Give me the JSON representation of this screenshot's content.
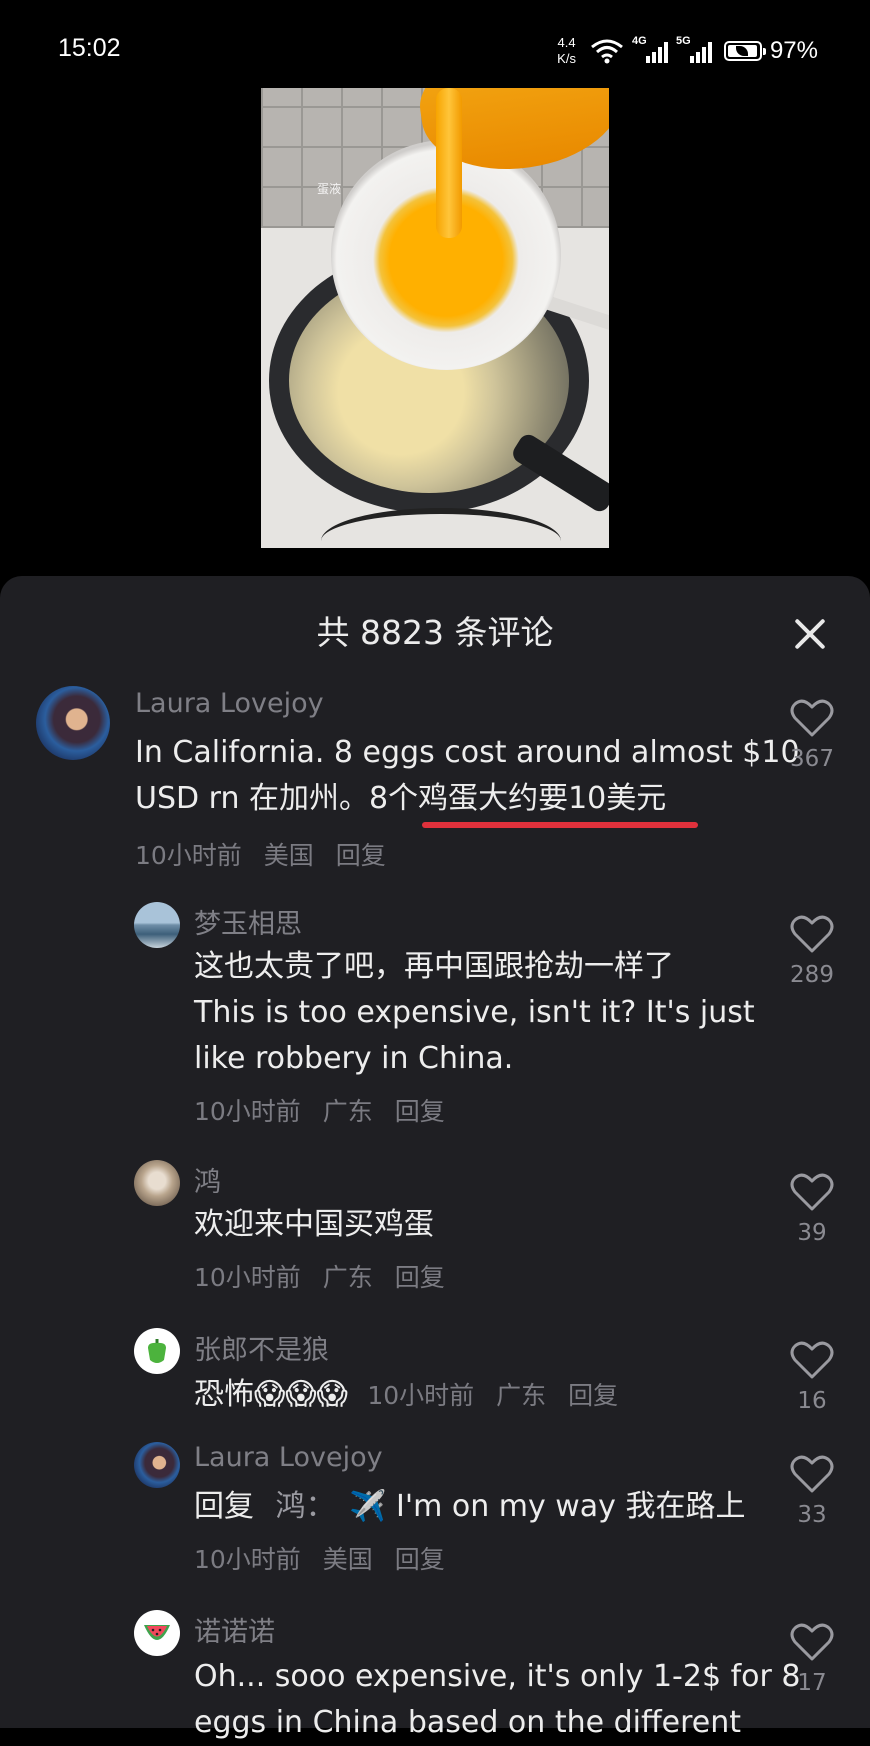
{
  "status_bar": {
    "time": "15:02",
    "net_speed_top": "4.4",
    "net_speed_bottom": "K/s",
    "signal1_label": "4G",
    "signal2_label": "5G",
    "battery": "97%",
    "battery_level": 0.97,
    "icons": [
      "wifi-icon",
      "signal-icon",
      "battery-icon"
    ]
  },
  "video": {
    "watermark": "蛋液"
  },
  "comments_sheet": {
    "title": "共 8823 条评论",
    "comments": [
      {
        "author": "Laura Lovejoy",
        "text_part1": "In California. 8 eggs cost around almost $10",
        "text_part2": "USD rn 在加州。8个",
        "text_highlight": "鸡蛋大约要10美元",
        "time": "10小时前",
        "location": "美国",
        "reply": "回复",
        "likes": "367"
      },
      {
        "author": "梦玉相思",
        "text_line1": "这也太贵了吧，再中国跟抢劫一样了",
        "text_line2": "This is too expensive, isn't it? It's just",
        "text_line3": "like robbery in China.",
        "time": "10小时前",
        "location": "广东",
        "reply": "回复",
        "likes": "289"
      },
      {
        "author": "鸿",
        "text": "欢迎来中国买鸡蛋",
        "time": "10小时前",
        "location": "广东",
        "reply": "回复",
        "likes": "39"
      },
      {
        "author": "张郎不是狼",
        "text": "恐怖😱😱😱",
        "time": "10小时前",
        "location": "广东",
        "reply": "回复",
        "likes": "16"
      },
      {
        "author": "Laura Lovejoy",
        "reply_prefix": "回复",
        "reply_target": "鸿：",
        "text": "✈️ I'm on my way 我在路上",
        "time": "10小时前",
        "location": "美国",
        "reply": "回复",
        "likes": "33"
      },
      {
        "author": "诺诺诺",
        "text_line1": "Oh... sooo expensive, it's only 1-2$ for 8",
        "text_line2": "eggs in China based on the different",
        "likes": "17"
      }
    ]
  }
}
